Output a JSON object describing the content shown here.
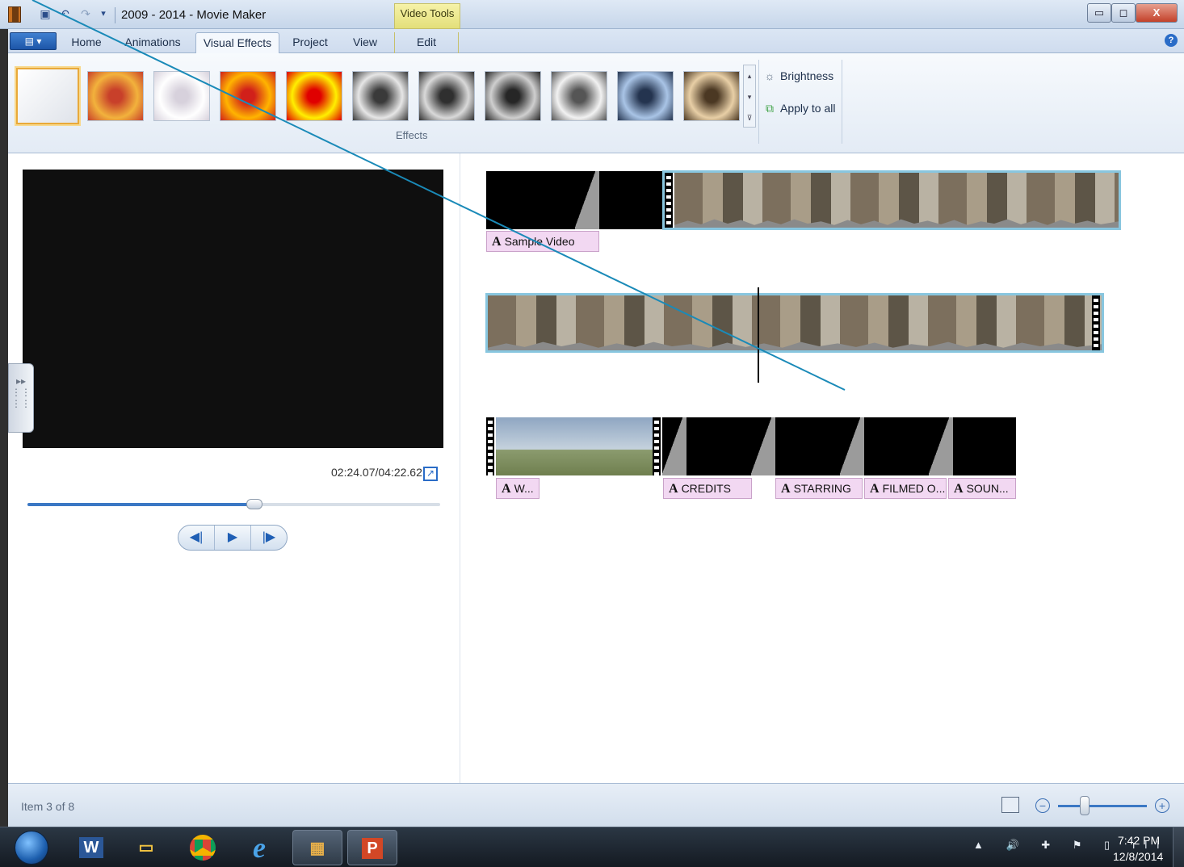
{
  "window": {
    "title": "2009 - 2014 - Movie Maker",
    "contextual_tab": "Video Tools",
    "controls": {
      "minimize": "▭",
      "maximize": "◻",
      "close": "X"
    }
  },
  "ribbon": {
    "app_menu_icon": "▤ ▾",
    "tabs": [
      {
        "label": "Home"
      },
      {
        "label": "Animations"
      },
      {
        "label": "Visual Effects"
      },
      {
        "label": "Project"
      },
      {
        "label": "View"
      },
      {
        "label": "Edit"
      }
    ],
    "active_tab": "Visual Effects",
    "help_icon": "?",
    "effects_group_label": "Effects",
    "effects": [
      {
        "name": "no-effect",
        "colors": [
          "#ffffff",
          "#dfe3ea"
        ]
      },
      {
        "name": "blur",
        "colors": [
          "#f2b23c",
          "#c8402a"
        ]
      },
      {
        "name": "edge-detection",
        "colors": [
          "#ffffff",
          "#d7d1dc"
        ]
      },
      {
        "name": "posterize",
        "colors": [
          "#ffb400",
          "#d1201a"
        ]
      },
      {
        "name": "threshold",
        "colors": [
          "#ffef00",
          "#e00000"
        ]
      },
      {
        "name": "black-and-white",
        "colors": [
          "#e6e6e6",
          "#3a3a3a"
        ]
      },
      {
        "name": "black-and-white-orange",
        "colors": [
          "#d9d9d9",
          "#2f2f2f"
        ]
      },
      {
        "name": "black-and-white-red",
        "colors": [
          "#cfcfcf",
          "#262626"
        ]
      },
      {
        "name": "black-and-white-yellow",
        "colors": [
          "#f2f2f2",
          "#555555"
        ]
      },
      {
        "name": "cyanotype",
        "colors": [
          "#a9c4e6",
          "#24344f"
        ]
      },
      {
        "name": "sepia",
        "colors": [
          "#e8cfa6",
          "#4b3823"
        ]
      }
    ],
    "commands": {
      "brightness": "Brightness",
      "apply_to_all": "Apply to all"
    }
  },
  "preview": {
    "time": "02:24.07/04:22.62",
    "seek_progress": 0.55,
    "controls": {
      "previous": "◀|",
      "play": "▶",
      "next": "|▶"
    }
  },
  "storyboard": {
    "row1_caption": "Sample Video",
    "row3_captions": [
      "W...",
      "CREDITS",
      "STARRING",
      "FILMED O...",
      "SOUN..."
    ]
  },
  "status": {
    "text": "Item 3 of 8",
    "zoom_level": 0.3
  },
  "taskbar": {
    "apps": [
      "word-icon",
      "file-explorer-icon",
      "chrome-icon",
      "internet-explorer-icon",
      "movie-maker-icon",
      "powerpoint-icon"
    ],
    "tray": "▲ 🔊 ✚ ⚑ ▯ ıll",
    "time": "7:42 PM",
    "date": "12/8/2014"
  }
}
